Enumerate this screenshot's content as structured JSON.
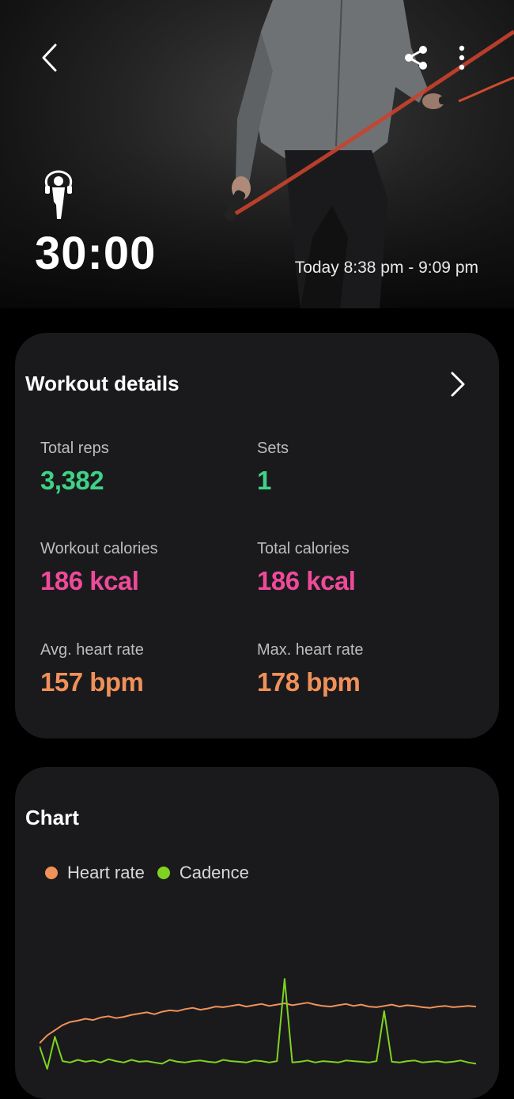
{
  "header": {
    "duration": "30:00",
    "time_range": "Today 8:38 pm - 9:09 pm"
  },
  "icons": {
    "back": "chevron-left-icon",
    "share": "share-icon",
    "more": "more-vertical-icon",
    "activity": "jump-rope-icon"
  },
  "workout_details": {
    "title": "Workout details",
    "stats": [
      {
        "label": "Total reps",
        "value": "3,382",
        "color": "#3fd286"
      },
      {
        "label": "Sets",
        "value": "1",
        "color": "#3fd286"
      },
      {
        "label": "Workout calories",
        "value": "186 kcal",
        "color": "#ef4a9a"
      },
      {
        "label": "Total calories",
        "value": "186 kcal",
        "color": "#ef4a9a"
      },
      {
        "label": "Avg. heart rate",
        "value": "157 bpm",
        "color": "#f0915a"
      },
      {
        "label": "Max. heart rate",
        "value": "178 bpm",
        "color": "#f0915a"
      }
    ]
  },
  "chart": {
    "title": "Chart",
    "legend": [
      {
        "name": "Heart rate",
        "color": "#f0915a"
      },
      {
        "name": "Cadence",
        "color": "#7ed321"
      }
    ]
  },
  "chart_data": {
    "type": "line",
    "title": "Chart",
    "series": [
      {
        "name": "Heart rate",
        "values": [
          100,
          112,
          120,
          128,
          133,
          135,
          138,
          136,
          140,
          142,
          139,
          141,
          144,
          146,
          148,
          145,
          149,
          151,
          150,
          153,
          155,
          152,
          154,
          157,
          156,
          158,
          160,
          157,
          159,
          161,
          158,
          160,
          162,
          159,
          161,
          163,
          160,
          158,
          157,
          159,
          161,
          158,
          160,
          157,
          156,
          158,
          160,
          157,
          159,
          158,
          156,
          155,
          157,
          158,
          156,
          157,
          158,
          157
        ]
      },
      {
        "name": "Cadence",
        "values": [
          95,
          60,
          110,
          72,
          70,
          74,
          71,
          73,
          70,
          75,
          72,
          70,
          74,
          71,
          72,
          70,
          68,
          74,
          71,
          70,
          72,
          73,
          71,
          70,
          74,
          72,
          71,
          70,
          73,
          72,
          70,
          72,
          200,
          70,
          71,
          73,
          70,
          72,
          71,
          70,
          73,
          72,
          71,
          70,
          72,
          150,
          71,
          70,
          72,
          73,
          70,
          71,
          72,
          70,
          71,
          73,
          70,
          68
        ]
      }
    ]
  }
}
